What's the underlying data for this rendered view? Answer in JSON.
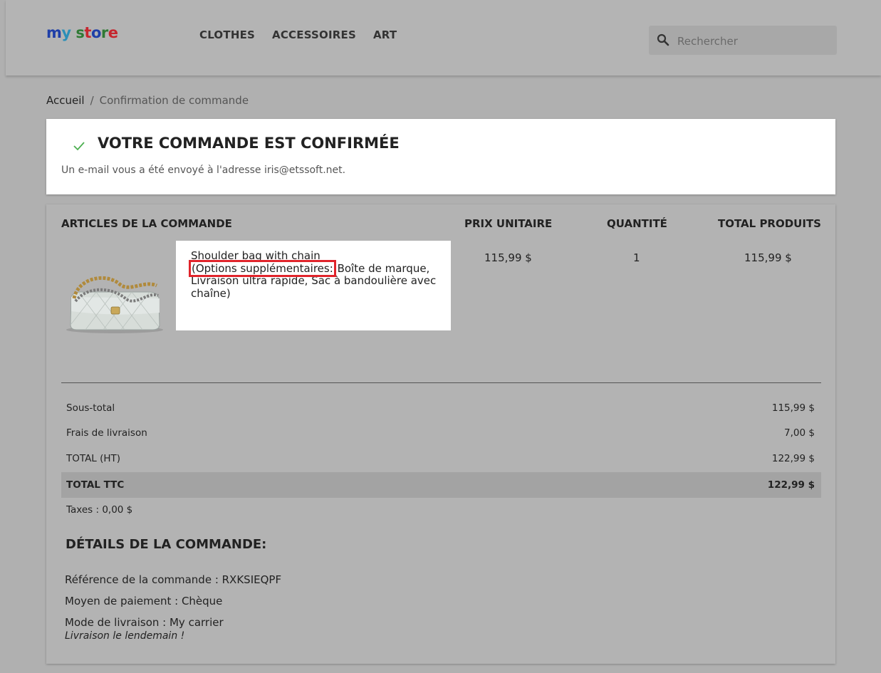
{
  "header": {
    "logo_parts": [
      "m",
      "y",
      "s",
      "t",
      "o",
      "r",
      "e"
    ],
    "nav": [
      "CLOTHES",
      "ACCESSOIRES",
      "ART"
    ],
    "search": {
      "placeholder": "Rechercher",
      "icon": "search-icon"
    }
  },
  "breadcrumb": {
    "home": "Accueil",
    "separator": "/",
    "current": "Confirmation de commande"
  },
  "confirmation": {
    "title": "VOTRE COMMANDE EST CONFIRMÉE",
    "email_message": "Un e-mail vous a été envoyé à l'adresse iris@etssoft.net.",
    "icon": "check-icon",
    "icon_color": "#4caf50"
  },
  "order": {
    "columns": {
      "items": "ARTICLES DE LA COMMANDE",
      "unit_price": "PRIX UNITAIRE",
      "quantity": "QUANTITÉ",
      "total": "TOTAL PRODUITS"
    },
    "product": {
      "name": "Shoulder bag with chain",
      "options_label": "(Options supplémentaires:",
      "options_value": "Boîte de marque, Livraison ultra rapide, Sac à bandoulière avec chaîne)",
      "unit_price": "115,99 $",
      "quantity": "1",
      "total": "115,99 $"
    },
    "totals": {
      "subtotal_label": "Sous-total",
      "subtotal_value": "115,99 $",
      "shipping_label": "Frais de livraison",
      "shipping_value": "7,00 $",
      "total_ht_label": "TOTAL (HT)",
      "total_ht_value": "122,99 $",
      "total_ttc_label": "TOTAL TTC",
      "total_ttc_value": "122,99 $",
      "taxes": "Taxes : 0,00 $"
    },
    "details": {
      "title": "DÉTAILS DE LA COMMANDE:",
      "reference": "Référence de la commande : RXKSIEQPF",
      "payment": "Moyen de paiement : Chèque",
      "shipping_method": "Mode de livraison : My carrier",
      "shipping_note": "Livraison le lendemain !"
    }
  },
  "colors": {
    "highlight_box": "#e0242b",
    "background": "#b0b0b0"
  }
}
